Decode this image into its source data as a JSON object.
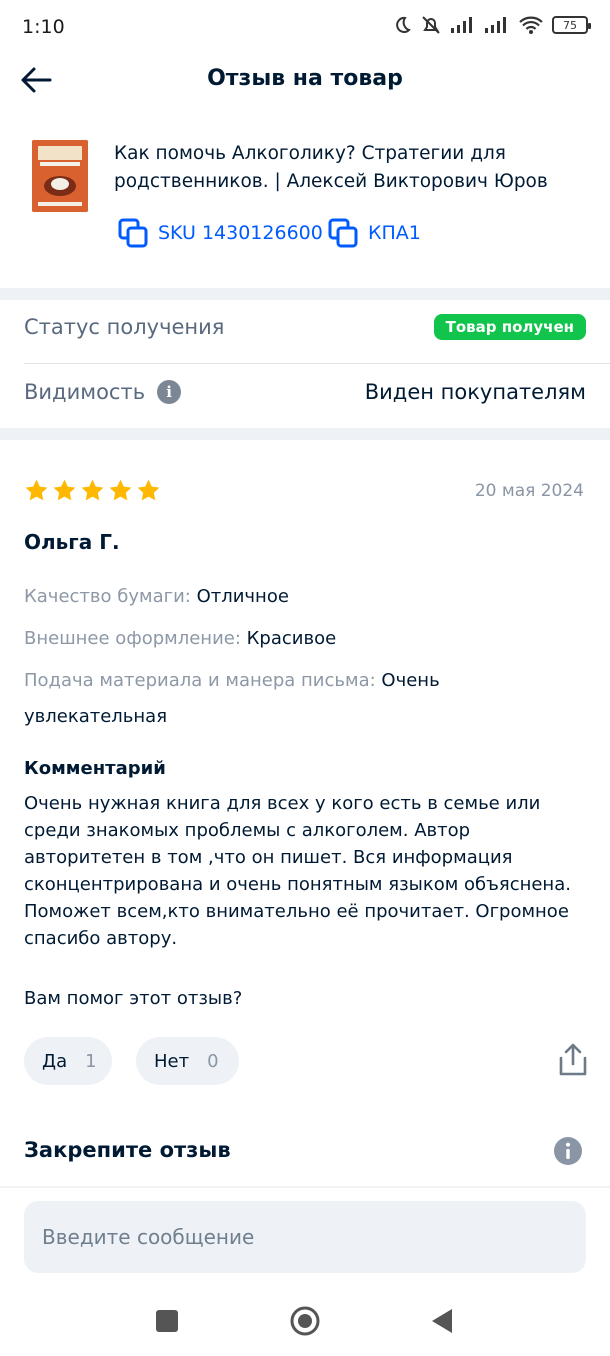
{
  "status_bar": {
    "time": "1:10",
    "battery": "75"
  },
  "header": {
    "title": "Отзыв на товар"
  },
  "product": {
    "name": "Как помочь Алкоголику? Стратегии для родственников. | Алексей Викторович Юров",
    "sku": "SKU 1430126600",
    "code": "КПА1"
  },
  "status": {
    "label": "Статус получения",
    "badge": "Товар получен"
  },
  "visibility": {
    "label": "Видимость",
    "value": "Виден покупателям"
  },
  "review": {
    "rating": 5,
    "date": "20 мая 2024",
    "author": "Ольга Г.",
    "attributes": [
      {
        "key": "Качество бумаги:",
        "value": "Отличное"
      },
      {
        "key": "Внешнее оформление:",
        "value": "Красивое"
      },
      {
        "key": "Подача материала и манера письма:",
        "value": "Очень увлекательная"
      }
    ],
    "comment_heading": "Комментарий",
    "comment": "Очень нужная книга для всех у кого есть в семье или среди знакомых проблемы с алкоголем. Автор авторитетен в том ,что он пишет. Вся информация сконцентрирована и очень понятным языком объяснена. Поможет всем,кто внимательно её прочитает. Огромное спасибо автору.",
    "helpful_question": "Вам помог этот отзыв?",
    "yes_label": "Да",
    "yes_count": "1",
    "no_label": "Нет",
    "no_count": "0"
  },
  "pin": {
    "heading": "Закрепите отзыв"
  },
  "message_input": {
    "placeholder": "Введите сообщение"
  },
  "colors": {
    "accent": "#005bff",
    "success": "#10c44c",
    "star": "#ffb800"
  }
}
